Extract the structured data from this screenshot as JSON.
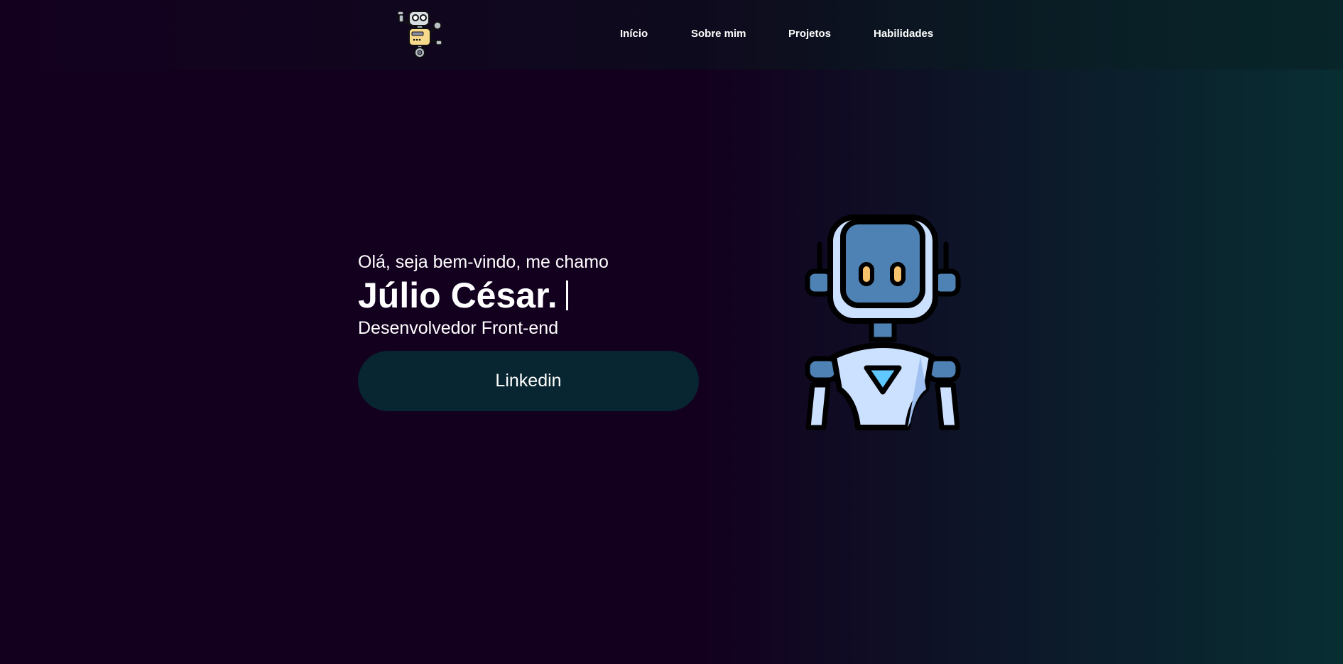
{
  "nav": {
    "logo_icon": "robot-logo-icon",
    "links": [
      {
        "label": "Início"
      },
      {
        "label": "Sobre mim"
      },
      {
        "label": "Projetos"
      },
      {
        "label": "Habilidades"
      }
    ]
  },
  "hero": {
    "greeting": "Olá, seja bem-vindo, me chamo",
    "name": "Júlio César.",
    "role": "Desenvolvedor Front-end",
    "button_label": "Linkedin",
    "illustration_icon": "robot-illustration-icon"
  },
  "colors": {
    "background_start": "#13001f",
    "background_end": "#082e32",
    "button_bg": "#082631",
    "robot_blue": "#4e82b4",
    "robot_light": "#cce0ff"
  }
}
